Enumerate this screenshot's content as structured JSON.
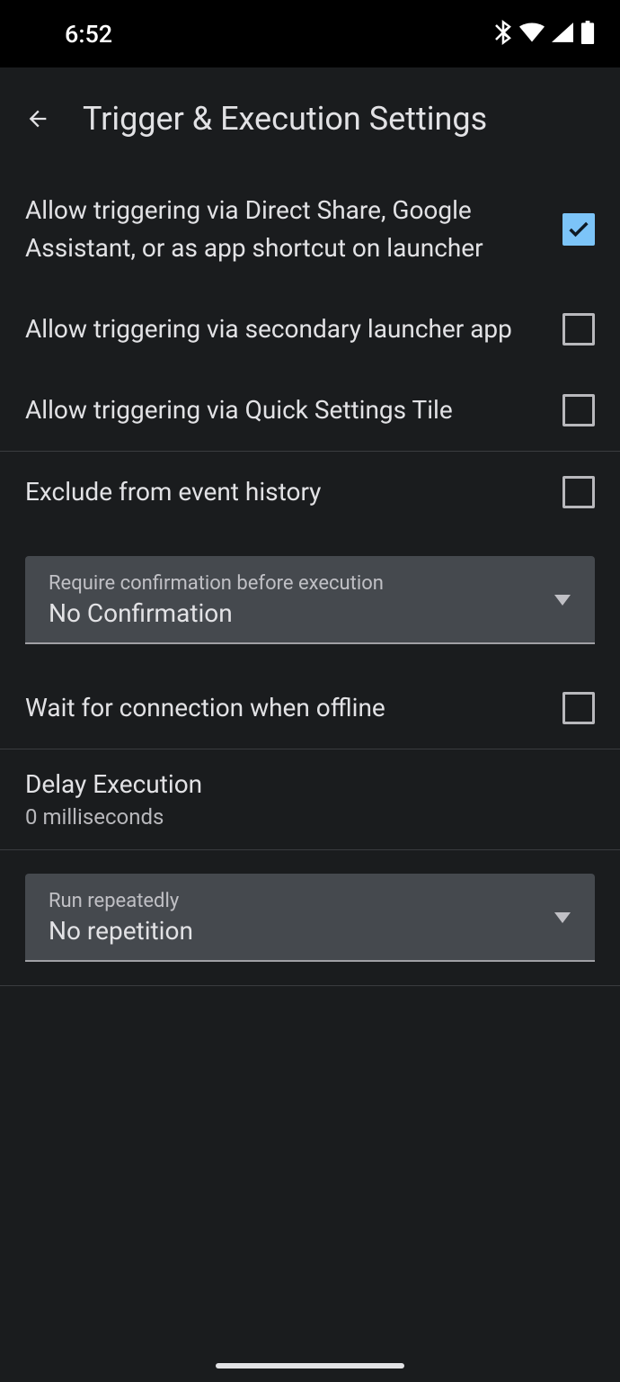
{
  "statusbar": {
    "time": "6:52"
  },
  "appbar": {
    "title": "Trigger & Execution Settings"
  },
  "settings": {
    "direct_share": {
      "label": "Allow triggering via Direct Share, Google Assistant, or as app shortcut on launcher",
      "checked": true
    },
    "secondary_launcher": {
      "label": "Allow triggering via secondary launcher app",
      "checked": false
    },
    "quick_settings": {
      "label": "Allow triggering via Quick Settings Tile",
      "checked": false
    },
    "exclude_history": {
      "label": "Exclude from event history",
      "checked": false
    },
    "confirmation": {
      "label": "Require confirmation before execution",
      "value": "No Confirmation"
    },
    "wait_connection": {
      "label": "Wait for connection when offline",
      "checked": false
    },
    "delay": {
      "label": "Delay Execution",
      "value": "0 milliseconds"
    },
    "repetition": {
      "label": "Run repeatedly",
      "value": "No repetition"
    }
  }
}
